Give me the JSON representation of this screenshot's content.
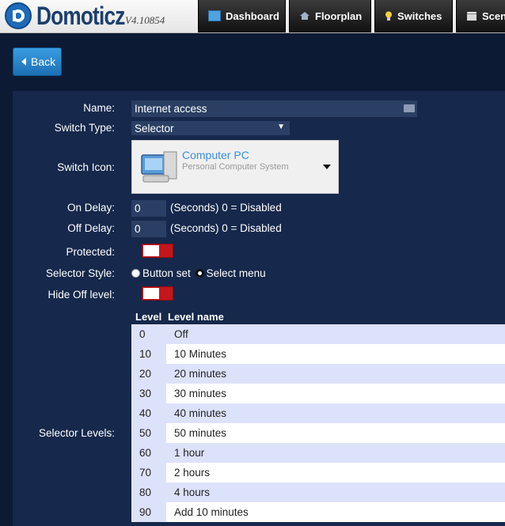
{
  "header": {
    "logo_text": "Domoticz",
    "version": "V4.10854",
    "tabs": [
      {
        "label": "Dashboard",
        "icon": "dashboard-icon",
        "color": "#4fa3e0"
      },
      {
        "label": "Floorplan",
        "icon": "house-icon",
        "color": "#9fb4c7"
      },
      {
        "label": "Switches",
        "icon": "lightbulb-icon",
        "color": "#f3d13a"
      },
      {
        "label": "Scen",
        "icon": "clapperboard-icon",
        "color": "#d9d9d9"
      }
    ]
  },
  "back_button": {
    "label": "Back"
  },
  "form": {
    "name": {
      "label": "Name:",
      "value": "Internet access"
    },
    "switch_type": {
      "label": "Switch Type:",
      "value": "Selector"
    },
    "switch_icon": {
      "label": "Switch Icon:",
      "title": "Computer PC",
      "subtitle": "Personal Computer System"
    },
    "on_delay": {
      "label": "On Delay:",
      "value": "0",
      "note": "(Seconds) 0 = Disabled"
    },
    "off_delay": {
      "label": "Off Delay:",
      "value": "0",
      "note": "(Seconds) 0 = Disabled"
    },
    "protected": {
      "label": "Protected:"
    },
    "selector_style": {
      "label": "Selector Style:",
      "option1": "Button set",
      "option2": "Select menu",
      "selected": "Select menu"
    },
    "hide_off_level": {
      "label": "Hide Off level:"
    },
    "selector_levels": {
      "label": "Selector Levels:",
      "headers": [
        "Level",
        "Level name"
      ],
      "rows": [
        {
          "level": "0",
          "name": "Off"
        },
        {
          "level": "10",
          "name": "10 Minutes"
        },
        {
          "level": "20",
          "name": "20 minutes"
        },
        {
          "level": "30",
          "name": "30 minutes"
        },
        {
          "level": "40",
          "name": "40 minutes"
        },
        {
          "level": "50",
          "name": "50 minutes"
        },
        {
          "level": "60",
          "name": "1 hour"
        },
        {
          "level": "70",
          "name": "2 hours"
        },
        {
          "level": "80",
          "name": "4 hours"
        },
        {
          "level": "90",
          "name": "Add 10 minutes"
        }
      ]
    }
  },
  "colors": {
    "background": "#0d1a33",
    "panel": "#16284b",
    "accent_blue": "#1c6fb5",
    "toggle_red": "#c4161c",
    "row_even": "#dde2fb",
    "row_odd": "#ffffff"
  }
}
